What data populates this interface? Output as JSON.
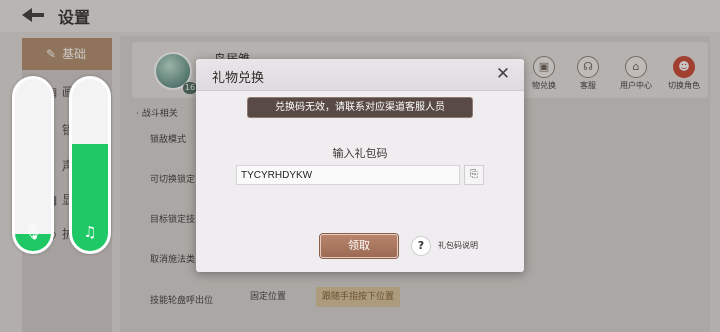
{
  "header": {
    "title": "设置"
  },
  "left_nav": {
    "items": [
      {
        "label": "基础",
        "glyph": "✎",
        "active": true
      },
      {
        "label": "画",
        "glyph": "▤",
        "active": false
      },
      {
        "label": "锁",
        "glyph": "⌂",
        "active": false
      },
      {
        "label": "声",
        "glyph": "♪",
        "active": false
      },
      {
        "label": "显",
        "glyph": "▦",
        "active": false
      },
      {
        "label": "护",
        "glyph": "◐",
        "active": false
      }
    ]
  },
  "profile": {
    "name": "鸟居雏",
    "level": "16",
    "quick_buttons": [
      {
        "label": "物兑换",
        "icon": "gift-icon",
        "glyph": "▣"
      },
      {
        "label": "客服",
        "icon": "headset-icon",
        "glyph": "☊"
      },
      {
        "label": "用户中心",
        "icon": "home-icon",
        "glyph": "⌂"
      },
      {
        "label": "切换角色",
        "icon": "user-icon",
        "glyph": "☻"
      }
    ]
  },
  "settings": {
    "section": "· 战斗相关",
    "rows": [
      "锁敌模式",
      "可切换锁定",
      "目标锁定技",
      "取消施法类",
      "技能轮盘呼出位"
    ],
    "options": [
      "固定位置",
      "跟随手指按下位置"
    ]
  },
  "volume": {
    "voice_level": 0.1,
    "music_level": 0.62,
    "voice_glyph": "🎙",
    "music_glyph": "♫"
  },
  "modal": {
    "title": "礼物兑换",
    "toast": "兑换码无效，请联系对应渠道客服人员",
    "input_label": "输入礼包码",
    "code_value": "TYCYRHDYKW",
    "claim_label": "领取",
    "help_glyph": "?",
    "help_label": "礼包码说明",
    "close_glyph": "✕",
    "paste_glyph": "⎘"
  },
  "colors": {
    "accent_green": "#1ec864",
    "claim_brown": "#9c6a54",
    "toast_bg": "#5a4a45"
  }
}
